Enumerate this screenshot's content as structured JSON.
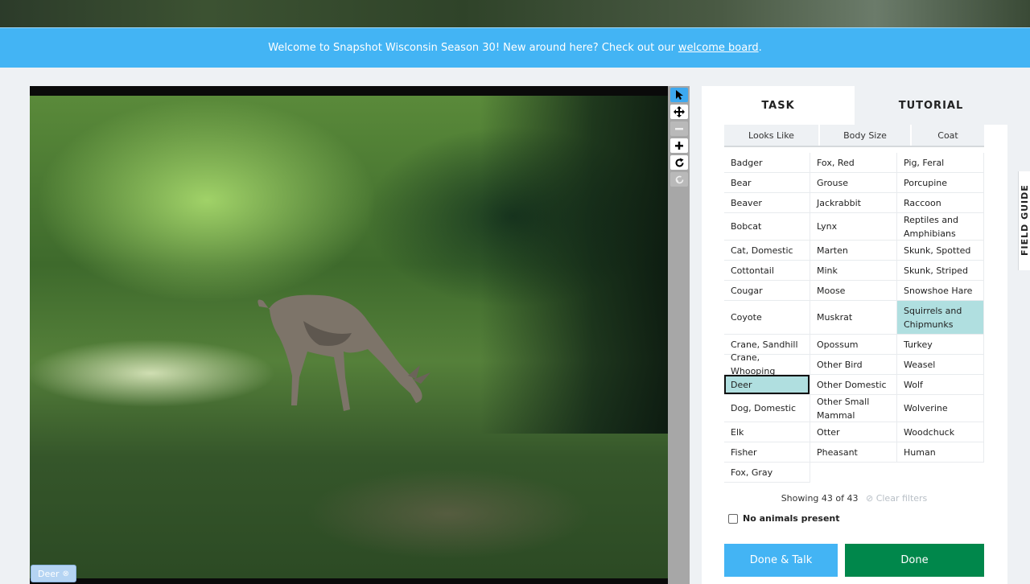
{
  "banner": {
    "text": "Welcome to Snapshot Wisconsin Season 30! New around here? Check out our",
    "link": "welcome board",
    "period": "."
  },
  "viewer": {
    "subject_label": "Deer",
    "label_close": "⊗"
  },
  "toolbar": {
    "icons": [
      "select-arrow-icon",
      "move-icon",
      "zoom-out-icon",
      "zoom-in-icon",
      "rotate-icon",
      "reset-icon"
    ]
  },
  "tabs": {
    "task": "TASK",
    "tutorial": "TUTORIAL"
  },
  "filters": {
    "looks_like": "Looks Like",
    "body_size": "Body Size",
    "coat": "Coat"
  },
  "choices": {
    "col1": [
      "Badger",
      "Bear",
      "Beaver",
      "Bobcat",
      "Cat, Domestic",
      "Cottontail",
      "Cougar",
      "Coyote",
      "Crane, Sandhill",
      "Crane, Whooping",
      "Deer",
      "Dog, Domestic",
      "Elk",
      "Fisher",
      "Fox, Gray"
    ],
    "col2": [
      "Fox, Red",
      "Grouse",
      "Jackrabbit",
      "Lynx",
      "Marten",
      "Mink",
      "Moose",
      "Muskrat",
      "Opossum",
      "Other Bird",
      "Other Domestic",
      "Other Small Mammal",
      "Otter",
      "Pheasant"
    ],
    "col3": [
      "Pig, Feral",
      "Porcupine",
      "Raccoon",
      "Reptiles and Amphibians",
      "Skunk, Spotted",
      "Skunk, Striped",
      "Snowshoe Hare",
      "Squirrels and Chipmunks",
      "Turkey",
      "Weasel",
      "Wolf",
      "Wolverine",
      "Woodchuck",
      "Human"
    ],
    "selected": [
      "Deer",
      "Squirrels and Chipmunks"
    ]
  },
  "status": {
    "showing": "Showing 43 of 43",
    "clear": "⊘ Clear filters"
  },
  "no_animals": "No animals present",
  "buttons": {
    "done_talk": "Done & Talk",
    "done": "Done"
  },
  "field_guide": "FIELD GUIDE",
  "colors": {
    "accent": "#43b4f4",
    "done": "#00874b",
    "selected": "#b0dfe0"
  }
}
